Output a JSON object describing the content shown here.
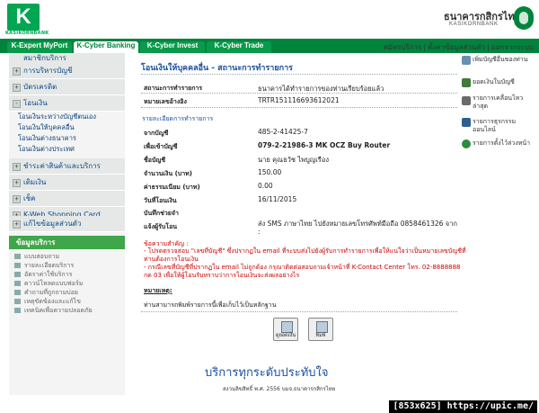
{
  "header": {
    "logo_letter": "K",
    "logo_caption": "KASIKORNBANK",
    "bank_name_th": "ธนาคารกสิกรไทย",
    "bank_name_en": "KASIKORNBANK",
    "tabs": [
      {
        "label": "K-Expert MyPort"
      },
      {
        "label": "K-Cyber Banking"
      },
      {
        "label": "K-Cyber Invest"
      },
      {
        "label": "K-Cyber Trade"
      }
    ],
    "links": [
      {
        "label": "สมัครบริการ"
      },
      {
        "label": "ตั้งค่าข้อมูลส่วนตัว"
      },
      {
        "label": "ออกจากระบบ"
      }
    ]
  },
  "sidebar": {
    "items": [
      {
        "label": "สมาชิกบริการ"
      },
      {
        "label": "การบริหารบัญชี"
      },
      {
        "label": "บัตรเครดิต"
      },
      {
        "label": "โอนเงิน"
      },
      {
        "label": "ชำระค่าสินค้าและบริการ"
      },
      {
        "label": "เติมเงิน"
      },
      {
        "label": "เช็ค"
      },
      {
        "label": "K-Web Shopping Card"
      },
      {
        "label": "แก้ไขข้อมูลส่วนตัว"
      }
    ],
    "transfer_subitems": [
      {
        "label": "โอนเงินระหว่างบัญชีตนเอง"
      },
      {
        "label": "โอนเงินให้บุคคลอื่น"
      },
      {
        "label": "โอนเงินต่างธนาคาร"
      },
      {
        "label": "โอนเงินต่างประเทศ"
      }
    ],
    "services_title": "ข้อมูลบริการ",
    "services": [
      {
        "label": "แบบสอบถาม"
      },
      {
        "label": "รายละเอียดบริการ"
      },
      {
        "label": "อัตราค่าใช้บริการ"
      },
      {
        "label": "ดาวน์โหลดแบบฟอร์ม"
      },
      {
        "label": "คำถามที่ถูกถามบ่อย"
      },
      {
        "label": "เหตุขัดข้องและแก้ไข"
      },
      {
        "label": "เทคนิคเพื่อความปลอดภัย"
      }
    ]
  },
  "main": {
    "title": "โอนเงินให้บุคคลอื่น - สถานะการทำรายการ",
    "status_label": "สถานะการทำรายการ",
    "status_value": "ธนาคารได้ทำรายการของท่านเรียบร้อยแล้ว",
    "ref_label": "หมายเลขอ้างอิง",
    "ref_value": "TRTR151116693612021",
    "detail_header": "รายละเอียดการทำรายการ",
    "fields": [
      {
        "label": "จากบัญชี",
        "value": "485-2-41425-7",
        "bold": false
      },
      {
        "label": "เพื่อเข้าบัญชี",
        "value": "079-2-21986-3 MK OCZ Buy Router",
        "bold": true
      },
      {
        "label": "ชื่อบัญชี",
        "value": "นาย คุณธวัช ไพบูญเรือง",
        "bold": false
      },
      {
        "label": "จำนวนเงิน (บาท)",
        "value": "150.00",
        "bold": false
      },
      {
        "label": "ค่าธรรมเนียม (บาท)",
        "value": "0.00",
        "bold": false
      },
      {
        "label": "วันที่โอนเงิน",
        "value": "16/11/2015",
        "bold": false
      },
      {
        "label": "บันทึกช่วยจำ",
        "value": "",
        "bold": false
      },
      {
        "label": "แจ้งผู้รับโอน",
        "value": "ส่ง SMS ภาษาไทย ไปยังหมายเลขโทรศัพท์มือถือ 0858461326 จาก :",
        "bold": false
      }
    ],
    "notice_title": "ข้อความสำคัญ :",
    "notices": [
      "- โปรดตรวจสอบ \"เลขที่บัญชี\" ซึ่งปรากฏใน email ที่ระบบส่งไปยังผู้รับการทำรายการเพื่อให้แน่ใจว่าเป็นหมายเลขบัญชีที่ท่านต้องการโอนเงิน",
      "- กรณีเลขที่บัญชีที่ปรากฏใน email ไม่ถูกต้อง กรุณาติดต่อสอบถามเจ้าหน้าที่ K-Contact Center โทร. 02-8888888 กด 03 เพื่อให้ผู้โอนรับทราบว่าการโอนเงินจะส่งผลอย่างไร"
    ],
    "remark_title": "หมายเหตุ:",
    "remark_text": "ท่านสามารถพิมพ์รายการนี้เพื่อเก็บไว้เป็นหลักฐาน",
    "buttons": [
      {
        "label": "ดูยอดเงิน"
      },
      {
        "label": "พิมพ์"
      }
    ]
  },
  "right_panel": {
    "links": [
      {
        "label": "เพิ่มบัญชีอื่นของท่าน",
        "icon": "account-add-icon"
      },
      {
        "label": "ยอดเงินในบัญชี",
        "icon": "balance-icon"
      },
      {
        "label": "รายการเคลื่อนไหวล่าสุด",
        "icon": "statement-icon"
      },
      {
        "label": "รายการธุรกรรมออนไลน์",
        "icon": "online-transaction-icon"
      },
      {
        "label": "รายการตั้งไว้ล่วงหน้า",
        "icon": "scheduled-icon"
      }
    ]
  },
  "footer": {
    "slogan": "บริการทุกระดับประทับใจ",
    "copyright": "สงวนลิขสิทธิ์ พ.ศ. 2556 บมจ.ธนาคารกสิกรไทย"
  },
  "watermark": "[853x625] https://upic.me/"
}
